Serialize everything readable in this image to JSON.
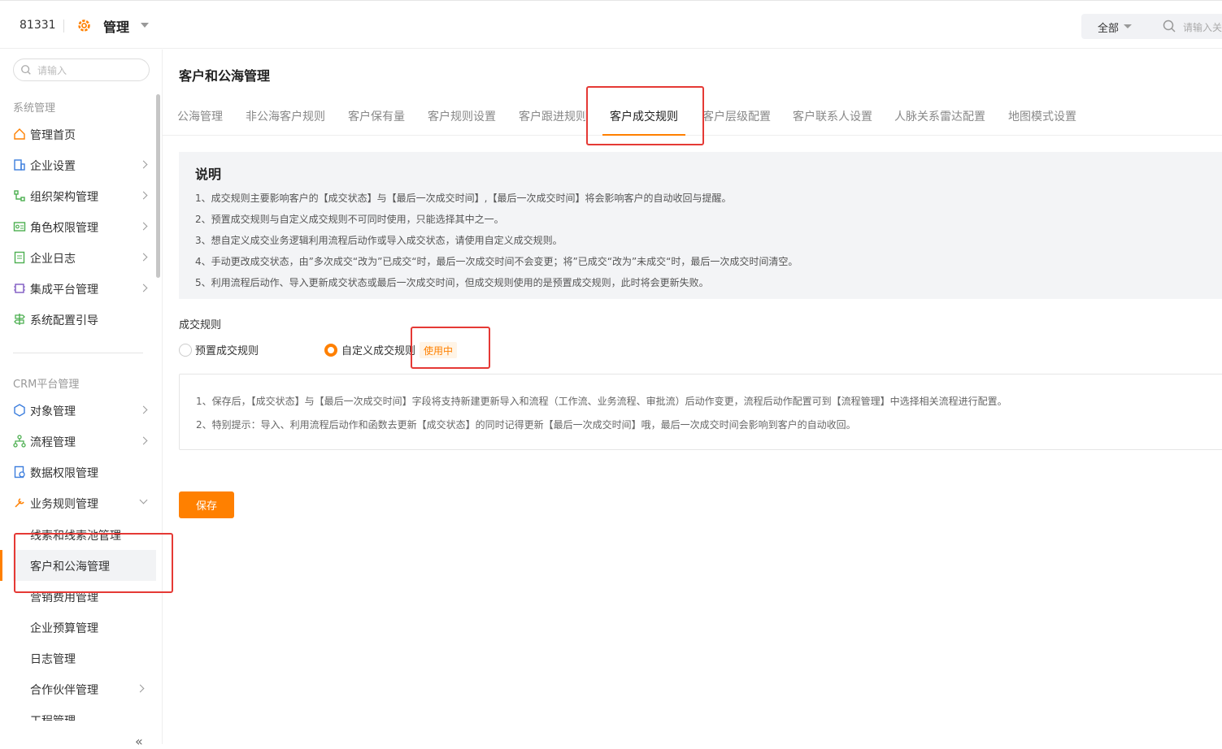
{
  "topbar": {
    "tenant_id": "81331",
    "app_title": "管理",
    "scope_label": "全部",
    "search_placeholder": "请输入关"
  },
  "sidebar": {
    "search_placeholder": "请输入",
    "groups": [
      {
        "title": "系统管理",
        "items": [
          {
            "label": "管理首页",
            "icon": "home-icon",
            "expandable": false
          },
          {
            "label": "企业设置",
            "icon": "enterprise-icon",
            "expandable": true
          },
          {
            "label": "组织架构管理",
            "icon": "org-structure-icon",
            "expandable": true
          },
          {
            "label": "角色权限管理",
            "icon": "role-permission-icon",
            "expandable": true
          },
          {
            "label": "企业日志",
            "icon": "log-icon",
            "expandable": true
          },
          {
            "label": "集成平台管理",
            "icon": "integration-icon",
            "expandable": true
          },
          {
            "label": "系统配置引导",
            "icon": "guide-icon",
            "expandable": false
          }
        ]
      },
      {
        "title": "CRM平台管理",
        "items": [
          {
            "label": "对象管理",
            "icon": "object-icon",
            "expandable": true
          },
          {
            "label": "流程管理",
            "icon": "flow-icon",
            "expandable": true
          },
          {
            "label": "数据权限管理",
            "icon": "data-permission-icon",
            "expandable": false
          },
          {
            "label": "业务规则管理",
            "icon": "business-rule-icon",
            "expandable": true,
            "expanded": true
          }
        ]
      }
    ],
    "sub_items": [
      {
        "label": "线索和线索池管理"
      },
      {
        "label": "客户和公海管理",
        "active": true
      },
      {
        "label": "营销费用管理"
      },
      {
        "label": "企业预算管理"
      },
      {
        "label": "日志管理"
      },
      {
        "label": "合作伙伴管理",
        "expandable": true
      },
      {
        "label": "工程管理"
      }
    ],
    "collapse_symbol": "«"
  },
  "main": {
    "page_title": "客户和公海管理",
    "tabs": [
      {
        "label": "公海管理"
      },
      {
        "label": "非公海客户规则"
      },
      {
        "label": "客户保有量"
      },
      {
        "label": "客户规则设置"
      },
      {
        "label": "客户跟进规则"
      },
      {
        "label": "客户成交规则",
        "active": true
      },
      {
        "label": "客户层级配置"
      },
      {
        "label": "客户联系人设置"
      },
      {
        "label": "人脉关系雷达配置"
      },
      {
        "label": "地图模式设置"
      }
    ],
    "notice": {
      "title": "说明",
      "lines": [
        "1、成交规则主要影响客户的【成交状态】与【最后一次成交时间】,【最后一次成交时间】将会影响客户的自动收回与提醒。",
        "2、预置成交规则与自定义成交规则不可同时使用，只能选择其中之一。",
        "3、想自定义成交业务逻辑利用流程后动作或导入成交状态，请使用自定义成交规则。",
        "4、手动更改成交状态，由”多次成交“改为”已成交“时，最后一次成交时间不会变更；将”已成交“改为”未成交“时，最后一次成交时间清空。",
        "5、利用流程后动作、导入更新成交状态或最后一次成交时间，但成交规则使用的是预置成交规则，此时将会更新失败。"
      ]
    },
    "rule_section_label": "成交规则",
    "rule_options": [
      {
        "label": "预置成交规则",
        "checked": false
      },
      {
        "label": "自定义成交规则",
        "checked": true
      }
    ],
    "in_use_badge": "使用中",
    "tips": [
      "1、保存后，【成交状态】与【最后一次成交时间】字段将支持新建更新导入和流程（工作流、业务流程、审批流）后动作变更，流程后动作配置可到【流程管理】中选择相关流程进行配置。",
      "2、特别提示：导入、利用流程后动作和函数去更新【成交状态】的同时记得更新【最后一次成交时间】哦，最后一次成交时间会影响到客户的自动收回。"
    ],
    "save_label": "保存"
  },
  "colors": {
    "accent": "#ff8000",
    "highlight_box": "#e53935",
    "notice_bg": "#f3f4f6",
    "badge_bg": "#fff4e6"
  }
}
